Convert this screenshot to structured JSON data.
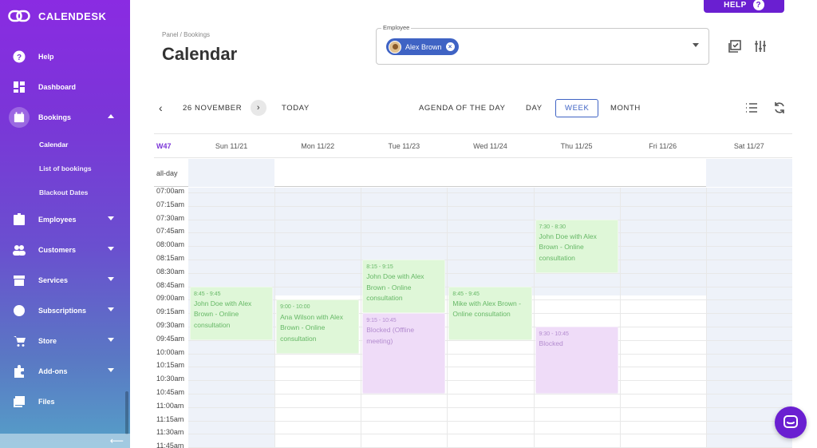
{
  "brand": {
    "name": "CALENDESK",
    "accent": "#7b35d8"
  },
  "sidebar": {
    "items": [
      {
        "id": "help",
        "label": "Help",
        "icon": "help-circle-icon",
        "chevron": ""
      },
      {
        "id": "dashboard",
        "label": "Dashboard",
        "icon": "dashboard-icon",
        "chevron": ""
      },
      {
        "id": "bookings",
        "label": "Bookings",
        "icon": "calendar-icon",
        "chevron": "up"
      },
      {
        "id": "employees",
        "label": "Employees",
        "icon": "employee-badge-icon",
        "chevron": "down"
      },
      {
        "id": "customers",
        "label": "Customers",
        "icon": "people-icon",
        "chevron": "down"
      },
      {
        "id": "services",
        "label": "Services",
        "icon": "store-icon",
        "chevron": "down"
      },
      {
        "id": "subscriptions",
        "label": "Subscriptions",
        "icon": "subscriptions-icon",
        "chevron": "down"
      },
      {
        "id": "store",
        "label": "Store",
        "icon": "cart-icon",
        "chevron": "down"
      },
      {
        "id": "addons",
        "label": "Add-ons",
        "icon": "puzzle-icon",
        "chevron": "down"
      },
      {
        "id": "files",
        "label": "Files",
        "icon": "images-icon",
        "chevron": ""
      }
    ],
    "bookings_sub": [
      "Calendar",
      "List of bookings",
      "Blackout Dates"
    ],
    "collapse_glyph": "⟵"
  },
  "header": {
    "help_label": "HELP",
    "breadcrumb": "Panel / Bookings",
    "title": "Calendar",
    "employee_label": "Employee",
    "employee_chip": "Alex Brown"
  },
  "toolbar": {
    "date": "26 NOVEMBER",
    "today": "TODAY",
    "views": [
      "AGENDA OF THE DAY",
      "DAY",
      "WEEK",
      "MONTH"
    ],
    "active_view": "WEEK"
  },
  "calendar": {
    "week_label": "W47",
    "days": [
      "Sun 11/21",
      "Mon 11/22",
      "Tue 11/23",
      "Wed 11/24",
      "Thu 11/25",
      "Fri 11/26",
      "Sat 11/27"
    ],
    "allday_label": "all-day",
    "times": [
      "07:00am",
      "07:15am",
      "07:30am",
      "07:45am",
      "08:00am",
      "08:15am",
      "08:30am",
      "08:45am",
      "09:00am",
      "09:15am",
      "09:30am",
      "09:45am",
      "10:00am",
      "10:15am",
      "10:30am",
      "10:45am",
      "11:00am",
      "11:15am",
      "11:30am",
      "11:45am"
    ],
    "events": [
      {
        "day": 0,
        "start": "08:45",
        "end": "09:45",
        "time": "8:45 - 9:45",
        "title": "John Doe with Alex Brown - Online consultation",
        "kind": "booking"
      },
      {
        "day": 1,
        "start": "09:00",
        "end": "10:00",
        "time": "9:00 - 10:00",
        "title": "Ana Wilson with Alex Brown - Online consultation",
        "kind": "booking"
      },
      {
        "day": 2,
        "start": "08:15",
        "end": "09:15",
        "time": "8:15 - 9:15",
        "title": "John Doe with Alex Brown - Online consultation",
        "kind": "booking"
      },
      {
        "day": 2,
        "start": "09:15",
        "end": "10:45",
        "time": "9:15 - 10:45",
        "title": "Blocked (Offline meeting)",
        "kind": "blocked"
      },
      {
        "day": 3,
        "start": "08:45",
        "end": "09:45",
        "time": "8:45 - 9:45",
        "title": "Mike with Alex Brown - Online consultation",
        "kind": "booking"
      },
      {
        "day": 4,
        "start": "07:30",
        "end": "08:30",
        "time": "7:30 - 8:30",
        "title": "John Doe with Alex Brown - Online consultation",
        "kind": "booking"
      },
      {
        "day": 4,
        "start": "09:30",
        "end": "10:45",
        "time": "9:30 - 10:45",
        "title": "Blocked",
        "kind": "blocked"
      }
    ]
  }
}
